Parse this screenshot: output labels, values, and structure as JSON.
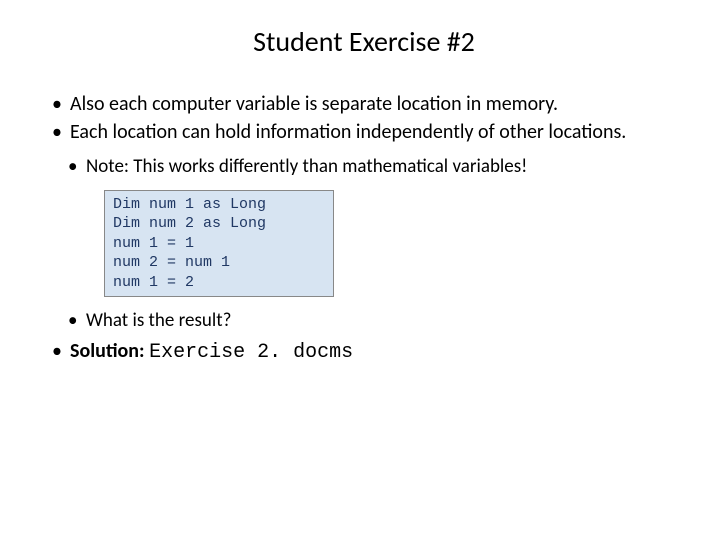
{
  "title": "Student Exercise #2",
  "bullets": {
    "b1": "Also each computer variable is separate location in memory.",
    "b2": "Each location can hold information independently of other locations.",
    "note": "Note: This works differently than mathematical variables!",
    "result_q": "What is the result?",
    "solution_label": "Solution: ",
    "solution_file": "Exercise 2. docms"
  },
  "code": "Dim num 1 as Long\nDim num 2 as Long\nnum 1 = 1\nnum 2 = num 1\nnum 1 = 2"
}
